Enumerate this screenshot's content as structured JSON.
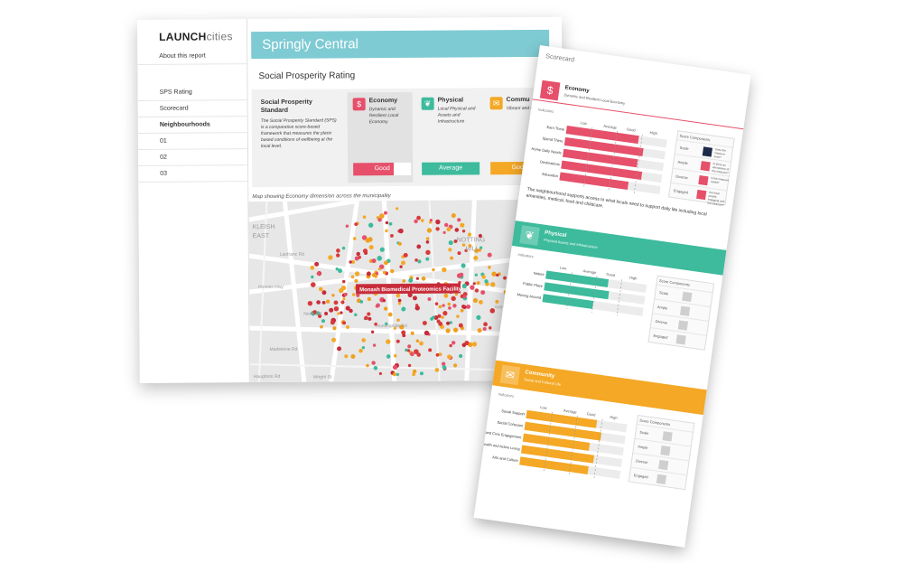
{
  "app": {
    "brand_bold": "LAUNCH",
    "brand_thin": "cities"
  },
  "sidebar": {
    "items": [
      {
        "label": "About this report",
        "bold": false
      },
      {
        "label": "SPS Rating",
        "bold": false
      },
      {
        "label": "Scorecard",
        "bold": false
      },
      {
        "label": "Neighbourhoods",
        "bold": true
      },
      {
        "label": "01",
        "bold": false
      },
      {
        "label": "02",
        "bold": false
      },
      {
        "label": "03",
        "bold": false
      }
    ]
  },
  "main": {
    "title": "Springly Central",
    "section_title": "Social Prosperity Rating",
    "standard": {
      "title": "Social Prosperity Standard",
      "desc": "The Social Prosperity Standard (SPS) is a comparative score-based framework that measures the place based conditions of wellbeing at the local level."
    },
    "cards": [
      {
        "name": "Economy",
        "desc": "Dynamic and Resilient Local Economy",
        "rating": "Good",
        "color": "#e6506a",
        "icon": "dollar-icon"
      },
      {
        "name": "Physical",
        "desc": "Local Physical and Assets and Infrastructure",
        "rating": "Average",
        "color": "#3dbb9c",
        "icon": "leaf-icon"
      },
      {
        "name": "Commu",
        "desc": "Vibrant and cultu life",
        "rating": "Good",
        "color": "#f4a825",
        "icon": "chat-icon"
      }
    ],
    "map": {
      "caption": "Map showing Economy dimension across the municipality",
      "tooltip": "Monash Biomedical Proteomics Facility",
      "labels": [
        "KLEISH",
        "EAST",
        "NOTTING",
        "HILL",
        "North Rd",
        "Princes Hwy",
        "Wright St",
        "Haughton Rd",
        "Madeleine Rd",
        "Lanfranc Rd",
        "Garden St",
        "Huntingdale Rd",
        "Parana"
      ]
    }
  },
  "scorecard": {
    "title": "Scorecard",
    "indicators_label": "Indicators",
    "scale": [
      "Low",
      "Average",
      "Good",
      "High"
    ],
    "components_title": "Score Components",
    "components": [
      "Scale",
      "Ample",
      "Diverse",
      "Engaged"
    ],
    "component_notes": [
      "Does the measure exist?",
      "Is there an abundance of the measure?",
      "Is the measure varied?",
      "Are local people engaging with the measure?"
    ],
    "sections": [
      {
        "name": "Economy",
        "sub": "Dynamic and Resilient Local Economy",
        "color": "#e6506a",
        "icon": "dollar-icon",
        "bars": [
          {
            "label": "Earn There",
            "value": 0.72
          },
          {
            "label": "Spend There",
            "value": 0.78
          },
          {
            "label": "Home Daily Needs",
            "value": 0.74
          },
          {
            "label": "Destinations",
            "value": 0.8
          },
          {
            "label": "Education",
            "value": 0.68
          }
        ],
        "note": "The neighbourhood supports access to what locals need to support daily life including local amenities, medical, food and childcare."
      },
      {
        "name": "Physical",
        "sub": "Physical Assets and Infrastructure",
        "color": "#3dbb9c",
        "icon": "leaf-icon",
        "bars": [
          {
            "label": "Nature",
            "value": 0.62
          },
          {
            "label": "Public Place",
            "value": 0.64
          },
          {
            "label": "Moving Around",
            "value": 0.5
          }
        ]
      },
      {
        "name": "Community",
        "sub": "Social and Cultural Life",
        "color": "#f4a825",
        "icon": "chat-icon",
        "bars": [
          {
            "label": "Social Support",
            "value": 0.7
          },
          {
            "label": "Social Cohesion",
            "value": 0.76
          },
          {
            "label": "Governance and Civic Engagement",
            "value": 0.66
          },
          {
            "label": "Health and Active Living",
            "value": 0.72
          },
          {
            "label": "Arts and Culture",
            "value": 0.68
          }
        ]
      }
    ]
  }
}
